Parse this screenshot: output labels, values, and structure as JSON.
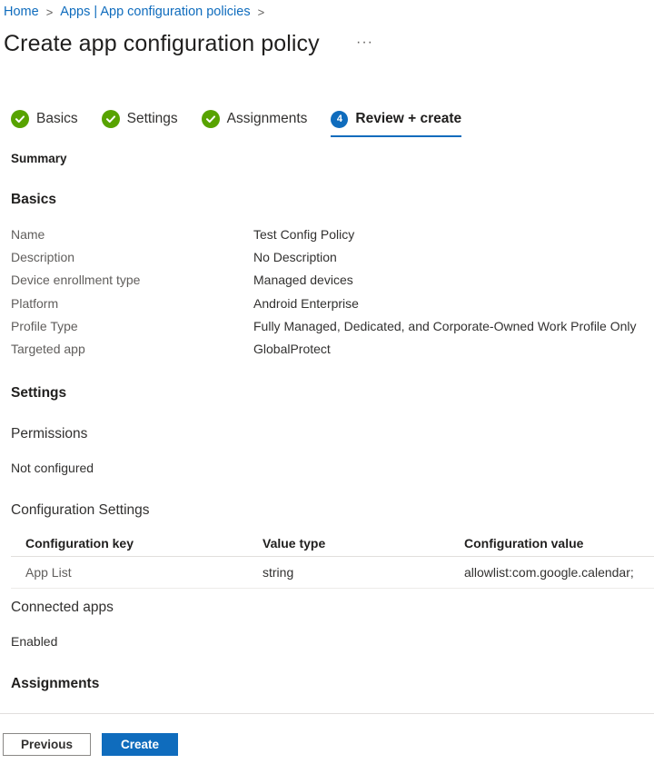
{
  "breadcrumb": {
    "items": [
      "Home",
      "Apps | App configuration policies"
    ],
    "separator": ">"
  },
  "page": {
    "title": "Create app configuration policy",
    "more_label": "···"
  },
  "wizard": {
    "steps": [
      {
        "label": "Basics",
        "state": "complete",
        "icon": "check-circle-icon"
      },
      {
        "label": "Settings",
        "state": "complete",
        "icon": "check-circle-icon"
      },
      {
        "label": "Assignments",
        "state": "complete",
        "icon": "check-circle-icon"
      },
      {
        "label": "Review + create",
        "state": "active",
        "number": "4"
      }
    ]
  },
  "summary": {
    "title": "Summary",
    "basics": {
      "heading": "Basics",
      "fields": [
        {
          "key": "Name",
          "value": "Test Config Policy"
        },
        {
          "key": "Description",
          "value": "No Description"
        },
        {
          "key": "Device enrollment type",
          "value": "Managed devices"
        },
        {
          "key": "Platform",
          "value": "Android Enterprise"
        },
        {
          "key": "Profile Type",
          "value": "Fully Managed, Dedicated, and Corporate-Owned Work Profile Only"
        },
        {
          "key": "Targeted app",
          "value": "GlobalProtect"
        }
      ]
    },
    "settings": {
      "heading": "Settings",
      "permissions": {
        "label": "Permissions",
        "value": "Not configured"
      },
      "configuration_settings": {
        "label": "Configuration Settings",
        "columns": [
          "Configuration key",
          "Value type",
          "Configuration value"
        ],
        "rows": [
          [
            "App List",
            "string",
            "allowlist:com.google.calendar;"
          ]
        ]
      },
      "connected_apps": {
        "label": "Connected apps",
        "value": "Enabled"
      }
    },
    "assignments": {
      "heading": "Assignments"
    }
  },
  "footer": {
    "previous_label": "Previous",
    "create_label": "Create"
  },
  "colors": {
    "accent": "#0f6cbd",
    "success": "#57a300"
  }
}
